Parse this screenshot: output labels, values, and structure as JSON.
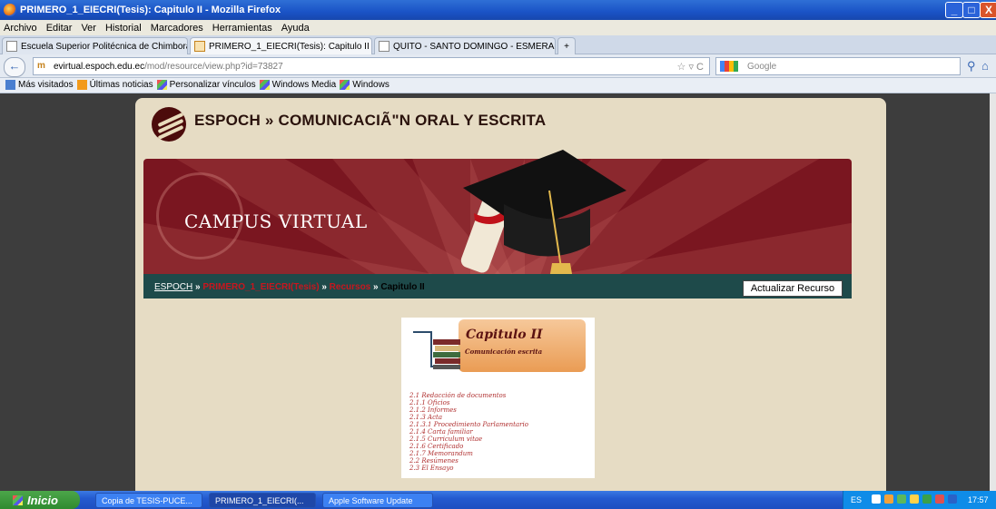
{
  "window": {
    "title": "PRIMERO_1_EIECRI(Tesis): Capitulo II - Mozilla Firefox",
    "controls": [
      "_",
      "□",
      "X"
    ]
  },
  "menu": [
    "Archivo",
    "Editar",
    "Ver",
    "Historial",
    "Marcadores",
    "Herramientas",
    "Ayuda"
  ],
  "tabs": [
    {
      "label": "Escuela Superior Politécnica de Chimborazo",
      "active": false
    },
    {
      "label": "PRIMERO_1_EIECRI(Tesis): Capitulo II",
      "active": true
    },
    {
      "label": "QUITO - SANTO DOMINGO - ESMERALDA...",
      "active": false
    }
  ],
  "new_tab": "+",
  "nav": {
    "back": "←",
    "url_host": "evirtual.espoch.edu.ec",
    "url_path": "/mod/resource/view.php?id=73827",
    "url_icon": "m",
    "url_right": "☆ ▿ C",
    "search_placeholder": "Google"
  },
  "bookmarks": [
    "Más visitados",
    "Últimas noticias",
    "Personalizar vínculos",
    "Windows Media",
    "Windows"
  ],
  "site": {
    "title": "ESPOCH » COMUNICACIÃ\"N ORAL Y ESCRITA",
    "banner_text": "CAMPUS VIRTUAL",
    "breadcrumb": {
      "home": "ESPOCH",
      "sep": " » ",
      "course": "PRIMERO_1_EIECRI(Tesis)",
      "section": "Recursos",
      "current": "Capitulo II"
    },
    "update_button": "Actualizar Recurso"
  },
  "document": {
    "title": "Capitulo II",
    "subtitle": "Comunicación escrita",
    "toc": [
      "2.1   Redacción de documentos",
      "2.1.1  Oficios",
      "2.1.2  Informes",
      "2.1.3  Acta",
      "2.1.3.1 Procedimiento Parlamentario",
      "2.1.4  Carta familiar",
      "2.1.5  Curriculum vitae",
      "2.1.6  Certificado",
      "2.1.7  Memorandum",
      "2.2   Resúmenes",
      "2.3   El Ensayo"
    ]
  },
  "taskbar": {
    "start": "Inicio",
    "items": [
      "Copia de TESIS-PUCE...",
      "PRIMERO_1_EIECRI(...",
      "Apple Software Update"
    ],
    "lang": "ES",
    "clock": "17:57"
  },
  "colors": {
    "titlebar": "#1a53c6",
    "banner": "#7a1620",
    "crumb_bar": "#1e4a4a",
    "panel": "#e6dcc4",
    "accent_red": "#c8161e"
  }
}
